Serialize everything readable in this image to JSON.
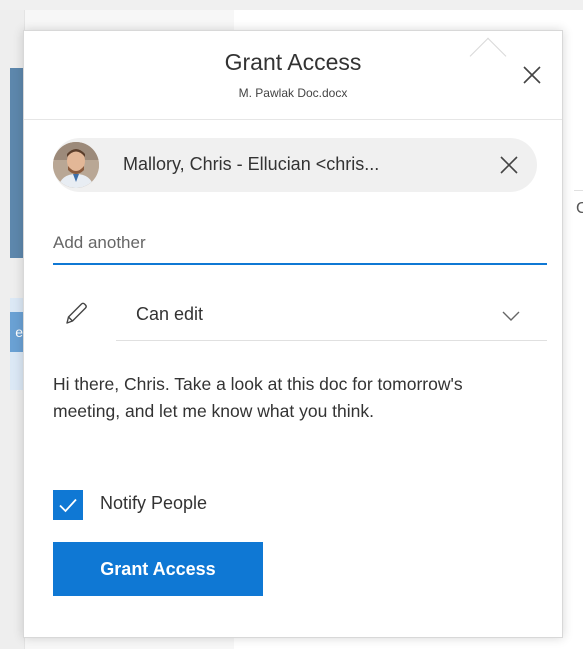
{
  "dialog": {
    "title": "Grant Access",
    "file_name": "M. Pawlak Doc.docx"
  },
  "recipient": {
    "display": "Mallory, Chris - Ellucian <chris..."
  },
  "add_field": {
    "value": "",
    "placeholder": "Add another"
  },
  "permission": {
    "selected": "Can edit"
  },
  "message": {
    "text": "Hi there, Chris. Take a look at this doc for tomorrow's meeting, and let me know what you think."
  },
  "notify": {
    "label": "Notify People",
    "checked": true
  },
  "actions": {
    "grant_label": "Grant Access"
  },
  "background": {
    "left_tab_letter": "e",
    "right_edge_letter": "C"
  },
  "colors": {
    "accent": "#0f78d4",
    "chip_bg": "#f0f0f0"
  },
  "icons": {
    "close": "close-icon",
    "remove_recipient": "close-icon",
    "permission": "pencil-icon",
    "dropdown": "chevron-down-icon",
    "checkbox": "checkmark-icon"
  }
}
